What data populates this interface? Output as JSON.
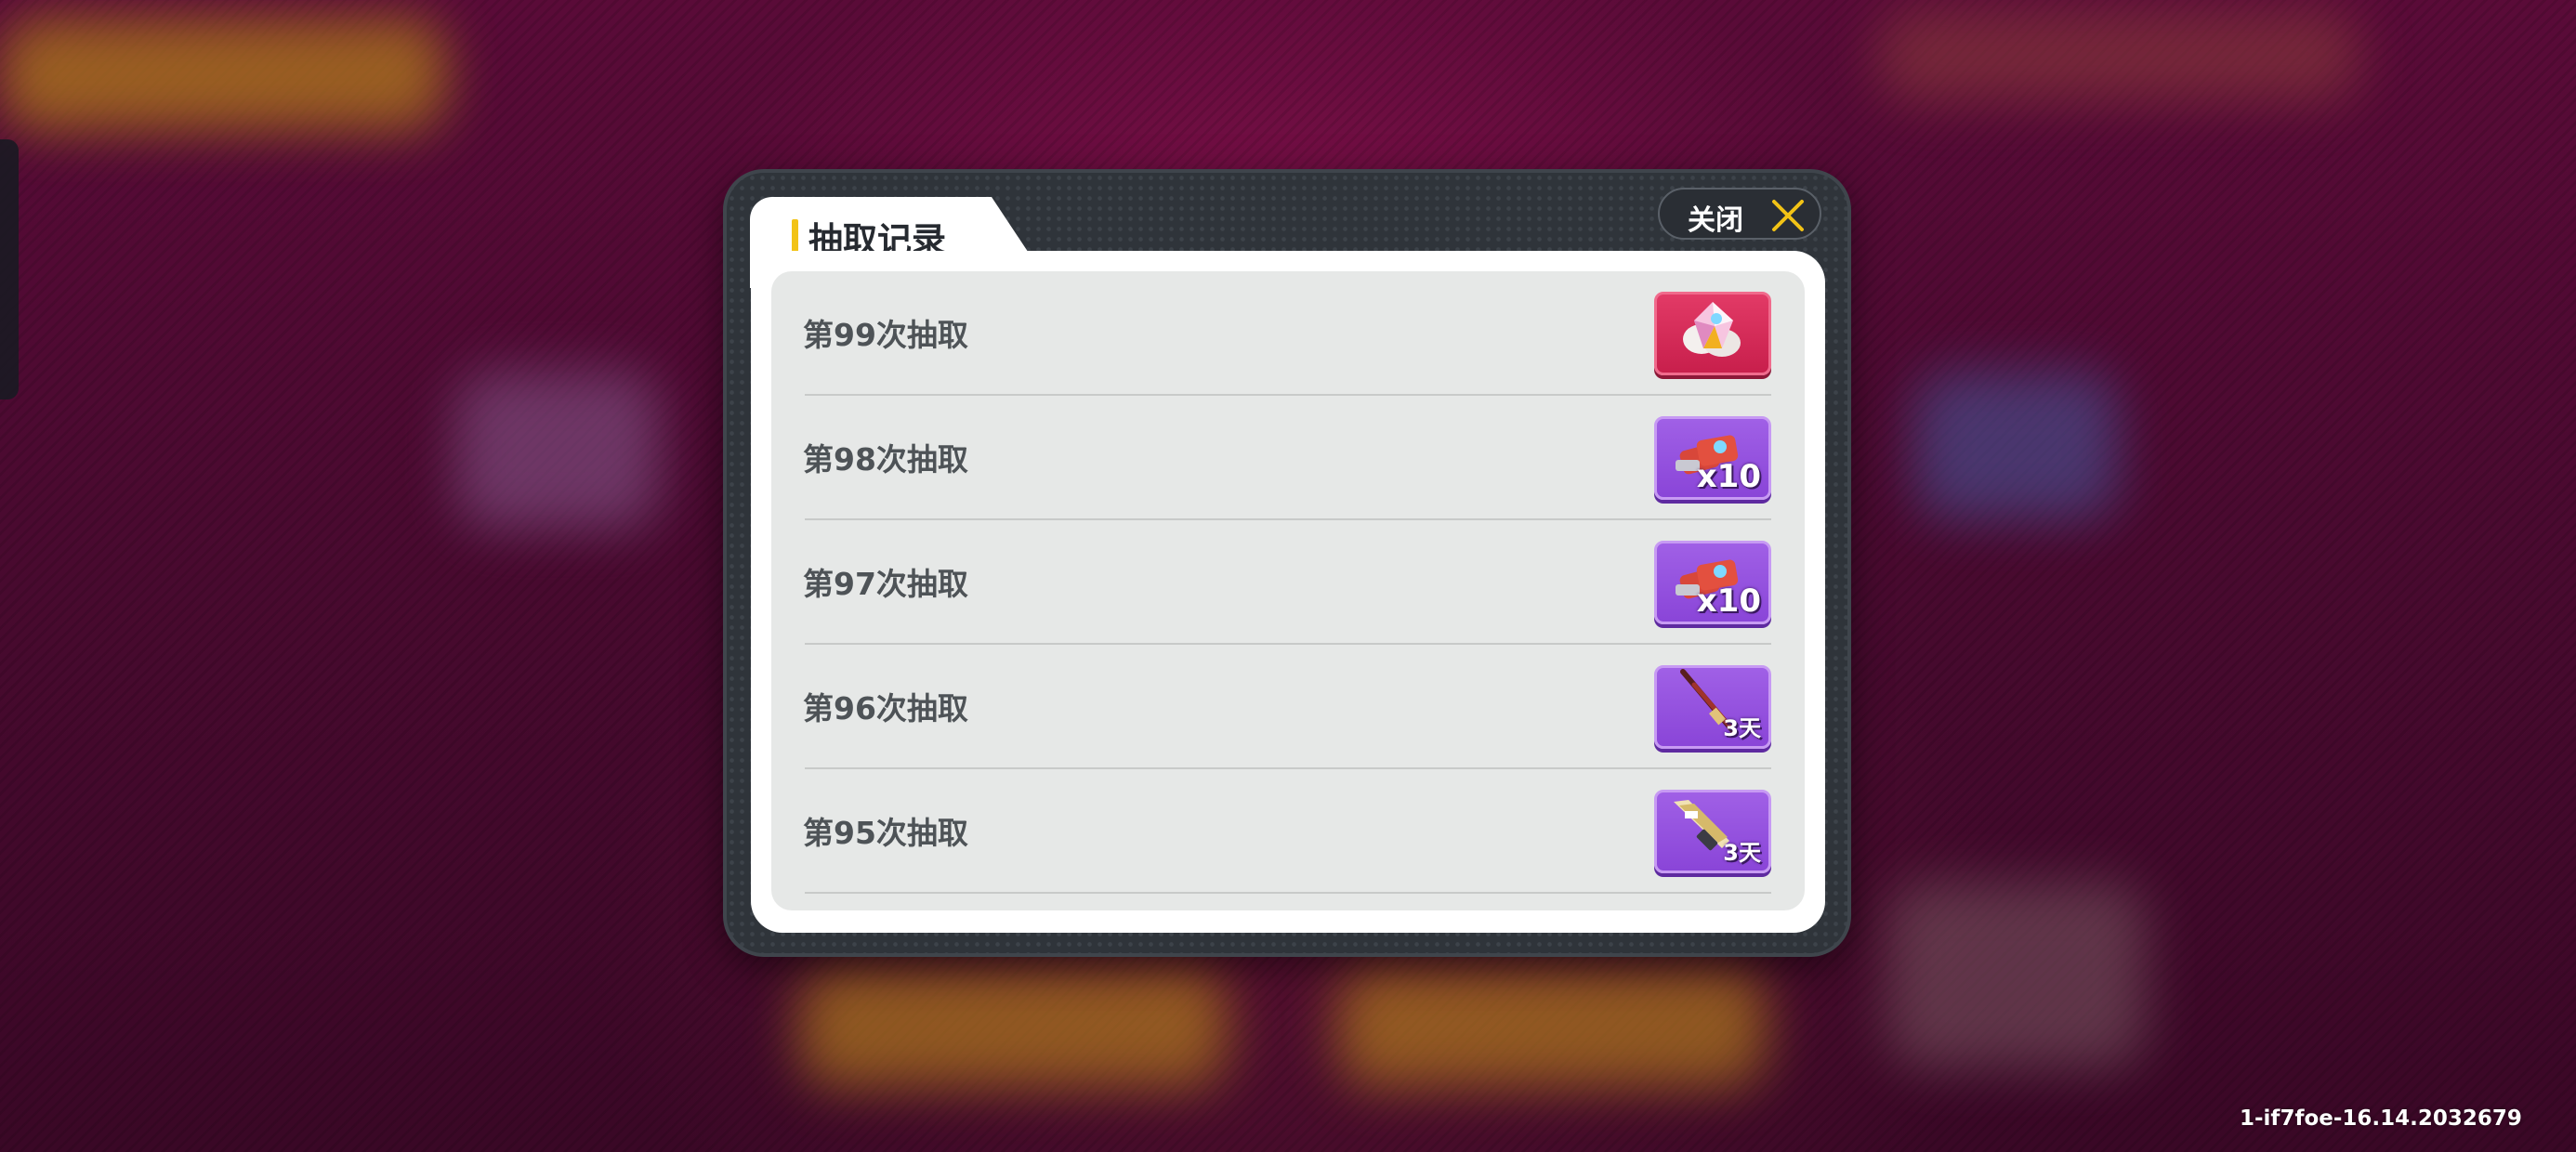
{
  "dialog": {
    "title": "抽取记录",
    "close_label": "关闭"
  },
  "records": [
    {
      "label": "第99次抽取",
      "item_icon": "crystal-gem-icon",
      "rarity": "red",
      "quantity": ""
    },
    {
      "label": "第98次抽取",
      "item_icon": "ticket-bundle-icon",
      "rarity": "purple",
      "quantity": "x10"
    },
    {
      "label": "第97次抽取",
      "item_icon": "ticket-bundle-icon",
      "rarity": "purple",
      "quantity": "x10"
    },
    {
      "label": "第96次抽取",
      "item_icon": "rifle-weapon-icon",
      "rarity": "purple",
      "quantity": "3天"
    },
    {
      "label": "第95次抽取",
      "item_icon": "assault-rifle-weapon-icon",
      "rarity": "purple",
      "quantity": "3天"
    }
  ],
  "version_text": "1-if7foe-16.14.2032679",
  "colors": {
    "accent": "#f2c316",
    "rarity_red": "#d62a58",
    "rarity_purple": "#9552df"
  }
}
